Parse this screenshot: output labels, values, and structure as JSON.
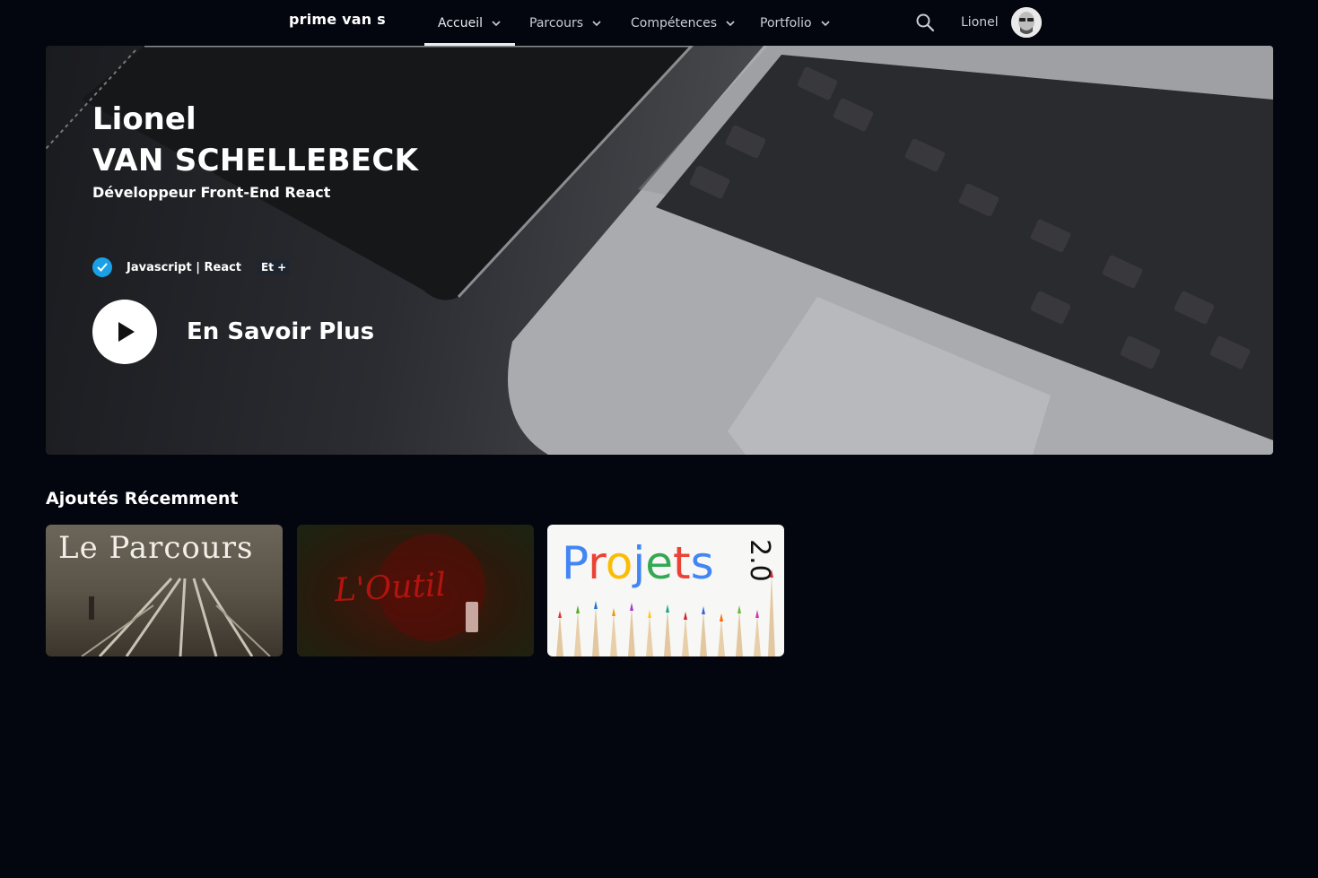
{
  "nav": {
    "brand": "prime van s",
    "items": [
      {
        "label": "Accueil",
        "active": true
      },
      {
        "label": "Parcours",
        "active": false
      },
      {
        "label": "Compétences",
        "active": false
      },
      {
        "label": "Portfolio",
        "active": false
      }
    ],
    "user": "Lionel",
    "search_icon": "search-icon"
  },
  "hero": {
    "first_name": "Lionel",
    "last_name": "VAN SCHELLEBECK",
    "subtitle": "Développeur Front-End React",
    "skills": "Javascript | React",
    "skills_more": "Et +",
    "cta": "En Savoir Plus",
    "check_color": "#1aa0e6"
  },
  "recent": {
    "title": "Ajoutés Récemment",
    "cards": [
      {
        "title": "Le Parcours"
      },
      {
        "title": "L'Outil"
      },
      {
        "title": "Projets",
        "suffix": "2.0"
      }
    ]
  }
}
